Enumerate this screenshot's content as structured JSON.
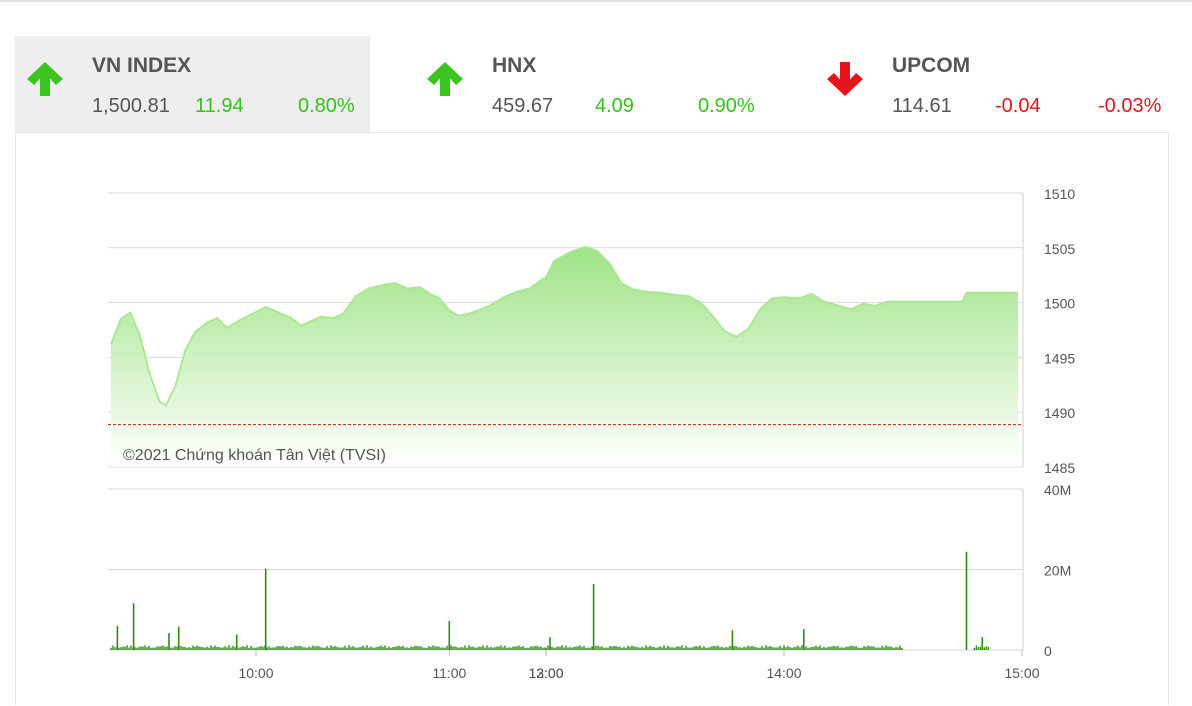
{
  "indices": [
    {
      "name": "VN INDEX",
      "value": "1,500.81",
      "change": "11.94",
      "percent": "0.80%",
      "direction": "up"
    },
    {
      "name": "HNX",
      "value": "459.67",
      "change": "4.09",
      "percent": "0.90%",
      "direction": "up"
    },
    {
      "name": "UPCOM",
      "value": "114.61",
      "change": "-0.04",
      "percent": "-0.03%",
      "direction": "down"
    }
  ],
  "colors": {
    "up": "#35c21b",
    "down": "#e8141b",
    "line": "#a8e890",
    "volume": "#2f8a10",
    "reference": "#d83020"
  },
  "chart_data": {
    "type": "area",
    "copyright": "©2021 Chứng khoán Tân Việt (TVSI)",
    "x_ticks": [
      "10:00",
      "11:00",
      "12:00",
      "13:00",
      "14:00",
      "15:00"
    ],
    "price": {
      "y_ticks": [
        "1510",
        "1505",
        "1500",
        "1495",
        "1490",
        "1485"
      ],
      "ylim": [
        1485,
        1510
      ],
      "reference_line": 1488.87,
      "points": [
        [
          "9:15",
          1496.2
        ],
        [
          "9:18",
          1498.5
        ],
        [
          "9:21",
          1499.1
        ],
        [
          "9:24",
          1497.0
        ],
        [
          "9:27",
          1493.5
        ],
        [
          "9:30",
          1491.0
        ],
        [
          "9:32",
          1490.6
        ],
        [
          "9:35",
          1492.4
        ],
        [
          "9:38",
          1495.6
        ],
        [
          "9:41",
          1497.3
        ],
        [
          "9:45",
          1498.2
        ],
        [
          "9:48",
          1498.6
        ],
        [
          "9:51",
          1497.7
        ],
        [
          "9:55",
          1498.4
        ],
        [
          "9:59",
          1499.0
        ],
        [
          "10:03",
          1499.6
        ],
        [
          "10:07",
          1499.1
        ],
        [
          "10:11",
          1498.6
        ],
        [
          "10:14",
          1497.9
        ],
        [
          "10:17",
          1498.3
        ],
        [
          "10:20",
          1498.7
        ],
        [
          "10:24",
          1498.6
        ],
        [
          "10:27",
          1499.0
        ],
        [
          "10:31",
          1500.6
        ],
        [
          "10:35",
          1501.3
        ],
        [
          "10:39",
          1501.6
        ],
        [
          "10:43",
          1501.8
        ],
        [
          "10:47",
          1501.3
        ],
        [
          "10:51",
          1501.4
        ],
        [
          "10:54",
          1500.8
        ],
        [
          "10:57",
          1500.4
        ],
        [
          "11:00",
          1499.3
        ],
        [
          "11:03",
          1498.8
        ],
        [
          "11:06",
          1499.0
        ],
        [
          "11:09",
          1499.3
        ],
        [
          "11:13",
          1499.8
        ],
        [
          "11:17",
          1500.5
        ],
        [
          "11:21",
          1501.0
        ],
        [
          "11:25",
          1501.3
        ],
        [
          "11:29",
          1502.2
        ],
        [
          "11:30",
          1502.2
        ],
        [
          "13:00",
          1502.3
        ],
        [
          "13:02",
          1503.8
        ],
        [
          "13:06",
          1504.6
        ],
        [
          "13:10",
          1505.1
        ],
        [
          "13:13",
          1504.7
        ],
        [
          "13:16",
          1503.6
        ],
        [
          "13:19",
          1501.8
        ],
        [
          "13:22",
          1501.2
        ],
        [
          "13:25",
          1501.0
        ],
        [
          "13:29",
          1500.9
        ],
        [
          "13:33",
          1500.7
        ],
        [
          "13:36",
          1500.6
        ],
        [
          "13:39",
          1500.0
        ],
        [
          "13:42",
          1498.8
        ],
        [
          "13:45",
          1497.4
        ],
        [
          "13:48",
          1496.9
        ],
        [
          "13:51",
          1497.6
        ],
        [
          "13:54",
          1499.4
        ],
        [
          "13:57",
          1500.4
        ],
        [
          "14:00",
          1500.5
        ],
        [
          "14:04",
          1500.4
        ],
        [
          "14:07",
          1500.8
        ],
        [
          "14:10",
          1500.1
        ],
        [
          "14:14",
          1499.7
        ],
        [
          "14:17",
          1499.4
        ],
        [
          "14:20",
          1499.9
        ],
        [
          "14:23",
          1499.7
        ],
        [
          "14:26",
          1500.1
        ],
        [
          "14:30",
          1500.1
        ],
        [
          "14:45",
          1500.1
        ],
        [
          "14:46",
          1500.9
        ],
        [
          "14:59",
          1500.9
        ]
      ]
    },
    "volume": {
      "y_ticks": [
        "40M",
        "20M",
        "0"
      ],
      "ylim": [
        0,
        40
      ],
      "unit": "M",
      "spikes": [
        [
          "9:17",
          6.0
        ],
        [
          "9:22",
          11.6
        ],
        [
          "9:33",
          4.2
        ],
        [
          "9:36",
          5.8
        ],
        [
          "9:54",
          3.8
        ],
        [
          "10:03",
          20.2
        ],
        [
          "11:00",
          7.2
        ],
        [
          "13:01",
          3.1
        ],
        [
          "13:12",
          16.4
        ],
        [
          "13:47",
          4.9
        ],
        [
          "14:05",
          5.2
        ],
        [
          "14:46",
          24.4
        ],
        [
          "14:50",
          3.2
        ]
      ],
      "typical_level": 1.2
    }
  }
}
